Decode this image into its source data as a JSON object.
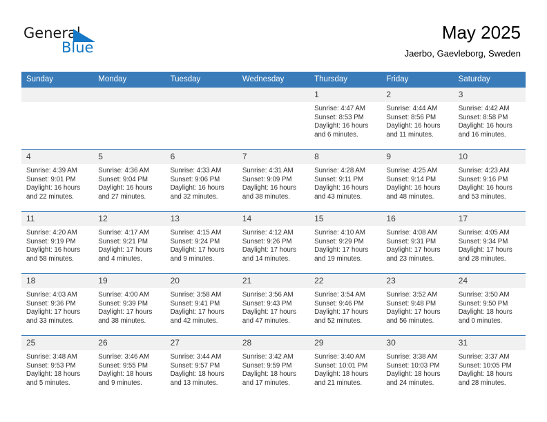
{
  "brand": {
    "name_part1": "General",
    "name_part2": "Blue",
    "triangle_color": "#1678c7",
    "blue_color": "#1077c4"
  },
  "header": {
    "month_title": "May 2025",
    "location": "Jaerbo, Gaevleborg, Sweden"
  },
  "theme": {
    "header_blue": "#3a7cba",
    "daynum_band": "#f1f1f1",
    "text": "#2b2b2b"
  },
  "weekday_headers": [
    "Sunday",
    "Monday",
    "Tuesday",
    "Wednesday",
    "Thursday",
    "Friday",
    "Saturday"
  ],
  "labels": {
    "sunrise_prefix": "Sunrise: ",
    "sunset_prefix": "Sunset: ",
    "daylight_prefix": "Daylight: "
  },
  "weeks": [
    [
      {
        "day": "",
        "sunrise": "",
        "sunset": "",
        "daylight_line1": "",
        "daylight_line2": "",
        "blank": true
      },
      {
        "day": "",
        "sunrise": "",
        "sunset": "",
        "daylight_line1": "",
        "daylight_line2": "",
        "blank": true
      },
      {
        "day": "",
        "sunrise": "",
        "sunset": "",
        "daylight_line1": "",
        "daylight_line2": "",
        "blank": true
      },
      {
        "day": "",
        "sunrise": "",
        "sunset": "",
        "daylight_line1": "",
        "daylight_line2": "",
        "blank": true
      },
      {
        "day": "1",
        "sunrise": "Sunrise: 4:47 AM",
        "sunset": "Sunset: 8:53 PM",
        "daylight_line1": "Daylight: 16 hours",
        "daylight_line2": "and 6 minutes."
      },
      {
        "day": "2",
        "sunrise": "Sunrise: 4:44 AM",
        "sunset": "Sunset: 8:56 PM",
        "daylight_line1": "Daylight: 16 hours",
        "daylight_line2": "and 11 minutes."
      },
      {
        "day": "3",
        "sunrise": "Sunrise: 4:42 AM",
        "sunset": "Sunset: 8:58 PM",
        "daylight_line1": "Daylight: 16 hours",
        "daylight_line2": "and 16 minutes."
      }
    ],
    [
      {
        "day": "4",
        "sunrise": "Sunrise: 4:39 AM",
        "sunset": "Sunset: 9:01 PM",
        "daylight_line1": "Daylight: 16 hours",
        "daylight_line2": "and 22 minutes."
      },
      {
        "day": "5",
        "sunrise": "Sunrise: 4:36 AM",
        "sunset": "Sunset: 9:04 PM",
        "daylight_line1": "Daylight: 16 hours",
        "daylight_line2": "and 27 minutes."
      },
      {
        "day": "6",
        "sunrise": "Sunrise: 4:33 AM",
        "sunset": "Sunset: 9:06 PM",
        "daylight_line1": "Daylight: 16 hours",
        "daylight_line2": "and 32 minutes."
      },
      {
        "day": "7",
        "sunrise": "Sunrise: 4:31 AM",
        "sunset": "Sunset: 9:09 PM",
        "daylight_line1": "Daylight: 16 hours",
        "daylight_line2": "and 38 minutes."
      },
      {
        "day": "8",
        "sunrise": "Sunrise: 4:28 AM",
        "sunset": "Sunset: 9:11 PM",
        "daylight_line1": "Daylight: 16 hours",
        "daylight_line2": "and 43 minutes."
      },
      {
        "day": "9",
        "sunrise": "Sunrise: 4:25 AM",
        "sunset": "Sunset: 9:14 PM",
        "daylight_line1": "Daylight: 16 hours",
        "daylight_line2": "and 48 minutes."
      },
      {
        "day": "10",
        "sunrise": "Sunrise: 4:23 AM",
        "sunset": "Sunset: 9:16 PM",
        "daylight_line1": "Daylight: 16 hours",
        "daylight_line2": "and 53 minutes."
      }
    ],
    [
      {
        "day": "11",
        "sunrise": "Sunrise: 4:20 AM",
        "sunset": "Sunset: 9:19 PM",
        "daylight_line1": "Daylight: 16 hours",
        "daylight_line2": "and 58 minutes."
      },
      {
        "day": "12",
        "sunrise": "Sunrise: 4:17 AM",
        "sunset": "Sunset: 9:21 PM",
        "daylight_line1": "Daylight: 17 hours",
        "daylight_line2": "and 4 minutes."
      },
      {
        "day": "13",
        "sunrise": "Sunrise: 4:15 AM",
        "sunset": "Sunset: 9:24 PM",
        "daylight_line1": "Daylight: 17 hours",
        "daylight_line2": "and 9 minutes."
      },
      {
        "day": "14",
        "sunrise": "Sunrise: 4:12 AM",
        "sunset": "Sunset: 9:26 PM",
        "daylight_line1": "Daylight: 17 hours",
        "daylight_line2": "and 14 minutes."
      },
      {
        "day": "15",
        "sunrise": "Sunrise: 4:10 AM",
        "sunset": "Sunset: 9:29 PM",
        "daylight_line1": "Daylight: 17 hours",
        "daylight_line2": "and 19 minutes."
      },
      {
        "day": "16",
        "sunrise": "Sunrise: 4:08 AM",
        "sunset": "Sunset: 9:31 PM",
        "daylight_line1": "Daylight: 17 hours",
        "daylight_line2": "and 23 minutes."
      },
      {
        "day": "17",
        "sunrise": "Sunrise: 4:05 AM",
        "sunset": "Sunset: 9:34 PM",
        "daylight_line1": "Daylight: 17 hours",
        "daylight_line2": "and 28 minutes."
      }
    ],
    [
      {
        "day": "18",
        "sunrise": "Sunrise: 4:03 AM",
        "sunset": "Sunset: 9:36 PM",
        "daylight_line1": "Daylight: 17 hours",
        "daylight_line2": "and 33 minutes."
      },
      {
        "day": "19",
        "sunrise": "Sunrise: 4:00 AM",
        "sunset": "Sunset: 9:39 PM",
        "daylight_line1": "Daylight: 17 hours",
        "daylight_line2": "and 38 minutes."
      },
      {
        "day": "20",
        "sunrise": "Sunrise: 3:58 AM",
        "sunset": "Sunset: 9:41 PM",
        "daylight_line1": "Daylight: 17 hours",
        "daylight_line2": "and 42 minutes."
      },
      {
        "day": "21",
        "sunrise": "Sunrise: 3:56 AM",
        "sunset": "Sunset: 9:43 PM",
        "daylight_line1": "Daylight: 17 hours",
        "daylight_line2": "and 47 minutes."
      },
      {
        "day": "22",
        "sunrise": "Sunrise: 3:54 AM",
        "sunset": "Sunset: 9:46 PM",
        "daylight_line1": "Daylight: 17 hours",
        "daylight_line2": "and 52 minutes."
      },
      {
        "day": "23",
        "sunrise": "Sunrise: 3:52 AM",
        "sunset": "Sunset: 9:48 PM",
        "daylight_line1": "Daylight: 17 hours",
        "daylight_line2": "and 56 minutes."
      },
      {
        "day": "24",
        "sunrise": "Sunrise: 3:50 AM",
        "sunset": "Sunset: 9:50 PM",
        "daylight_line1": "Daylight: 18 hours",
        "daylight_line2": "and 0 minutes."
      }
    ],
    [
      {
        "day": "25",
        "sunrise": "Sunrise: 3:48 AM",
        "sunset": "Sunset: 9:53 PM",
        "daylight_line1": "Daylight: 18 hours",
        "daylight_line2": "and 5 minutes."
      },
      {
        "day": "26",
        "sunrise": "Sunrise: 3:46 AM",
        "sunset": "Sunset: 9:55 PM",
        "daylight_line1": "Daylight: 18 hours",
        "daylight_line2": "and 9 minutes."
      },
      {
        "day": "27",
        "sunrise": "Sunrise: 3:44 AM",
        "sunset": "Sunset: 9:57 PM",
        "daylight_line1": "Daylight: 18 hours",
        "daylight_line2": "and 13 minutes."
      },
      {
        "day": "28",
        "sunrise": "Sunrise: 3:42 AM",
        "sunset": "Sunset: 9:59 PM",
        "daylight_line1": "Daylight: 18 hours",
        "daylight_line2": "and 17 minutes."
      },
      {
        "day": "29",
        "sunrise": "Sunrise: 3:40 AM",
        "sunset": "Sunset: 10:01 PM",
        "daylight_line1": "Daylight: 18 hours",
        "daylight_line2": "and 21 minutes."
      },
      {
        "day": "30",
        "sunrise": "Sunrise: 3:38 AM",
        "sunset": "Sunset: 10:03 PM",
        "daylight_line1": "Daylight: 18 hours",
        "daylight_line2": "and 24 minutes."
      },
      {
        "day": "31",
        "sunrise": "Sunrise: 3:37 AM",
        "sunset": "Sunset: 10:05 PM",
        "daylight_line1": "Daylight: 18 hours",
        "daylight_line2": "and 28 minutes."
      }
    ]
  ]
}
